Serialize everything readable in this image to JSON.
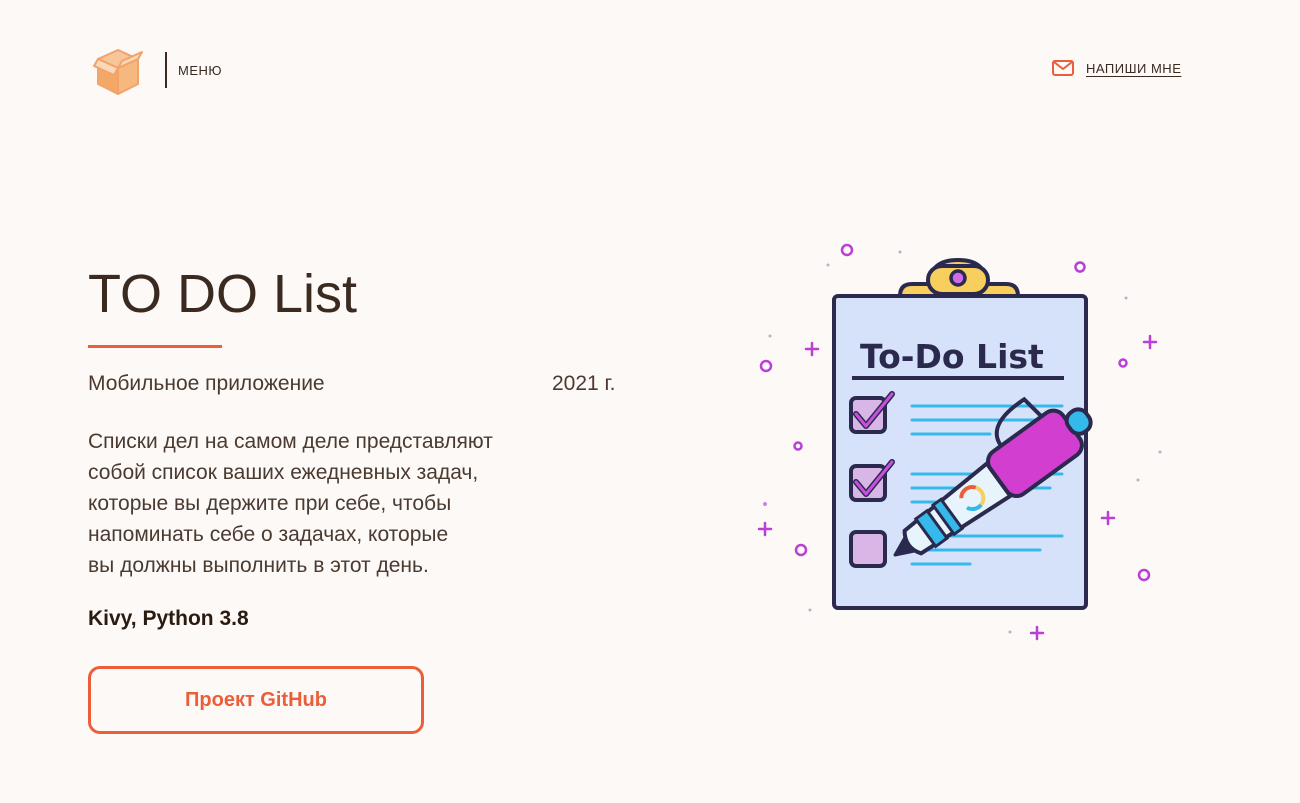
{
  "header": {
    "menu_label": "МЕНЮ",
    "contact_label": "НАПИШИ МНЕ"
  },
  "project": {
    "title": "TO DO List",
    "type": "Мобильное приложение",
    "year": "2021 г.",
    "description_lines": [
      "Списки дел на самом деле представляют",
      "собой список ваших ежедневных задач,",
      "которые вы держите при себе, чтобы",
      "напоминать себе о задачах, которые",
      "вы должны выполнить в этот день."
    ],
    "tech": "Kivy, Python 3.8",
    "button_label": "Проект GitHub"
  },
  "illustration": {
    "heading": "To-Do List"
  },
  "colors": {
    "accent": "#ec5e3a",
    "background": "#fcf9f7",
    "text": "#3a2a1f"
  },
  "icons": {
    "logo": "box-icon",
    "contact": "mail-icon"
  }
}
